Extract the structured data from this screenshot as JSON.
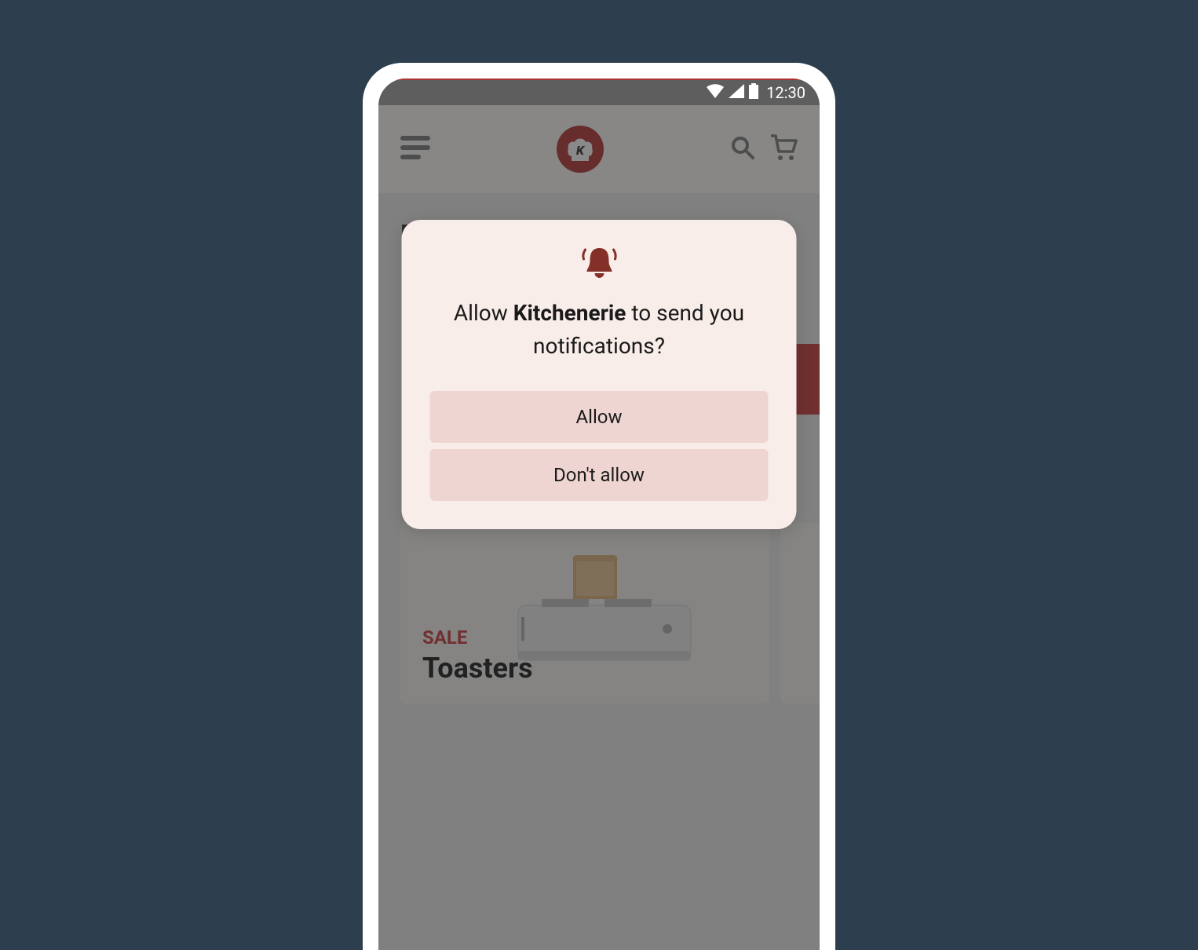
{
  "status": {
    "time": "12:30"
  },
  "header": {
    "logo_letter": "K"
  },
  "product": {
    "sale_label": "SALE",
    "name": "Toasters"
  },
  "dialog": {
    "prompt_pre": "Allow ",
    "brand": "Kitchenerie",
    "prompt_post": " to send you notifications?",
    "allow_label": "Allow",
    "deny_label": "Don't allow"
  }
}
